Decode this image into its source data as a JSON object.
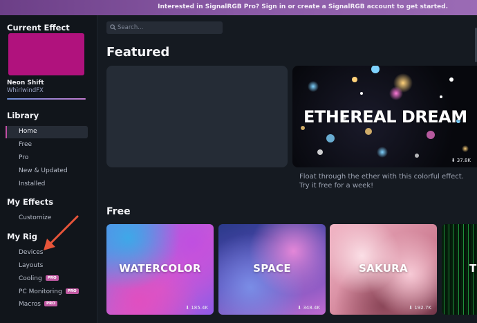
{
  "banner": {
    "text": "Interested in SignalRGB Pro?  Sign in or create a SignalRGB account to get started."
  },
  "sidebar": {
    "current_effect_heading": "Current Effect",
    "current_effect": {
      "name": "Neon Shift",
      "author": "WhirlwindFX",
      "preview_color": "#b0127d"
    },
    "library_heading": "Library",
    "library_items": [
      {
        "label": "Home",
        "active": true
      },
      {
        "label": "Free"
      },
      {
        "label": "Pro"
      },
      {
        "label": "New & Updated"
      },
      {
        "label": "Installed"
      }
    ],
    "my_effects_heading": "My Effects",
    "my_effects_items": [
      {
        "label": "Customize"
      }
    ],
    "my_rig_heading": "My Rig",
    "my_rig_items": [
      {
        "label": "Devices"
      },
      {
        "label": "Layouts"
      },
      {
        "label": "Cooling",
        "badge": "PRO"
      },
      {
        "label": "PC Monitoring",
        "badge": "PRO"
      },
      {
        "label": "Macros",
        "badge": "PRO"
      }
    ]
  },
  "search": {
    "placeholder": "Search..."
  },
  "featured": {
    "heading": "Featured",
    "card": {
      "title": "ETHEREAL DREAM",
      "downloads": "⬇ 37.8K",
      "description": "Float through the ether with this colorful effect. Try it free for a week!"
    }
  },
  "free": {
    "heading": "Free",
    "tiles": [
      {
        "title": "WATERCOLOR",
        "downloads": "⬇ 185.4K"
      },
      {
        "title": "SPACE",
        "downloads": "⬇ 348.4K"
      },
      {
        "title": "SAKURA",
        "downloads": "⬇ 192.7K"
      },
      {
        "title": "TH",
        "downloads": ""
      }
    ]
  },
  "colors": {
    "accent": "#c24ea5",
    "banner": "#8a5aa6",
    "annotation_arrow": "#e8553a"
  }
}
